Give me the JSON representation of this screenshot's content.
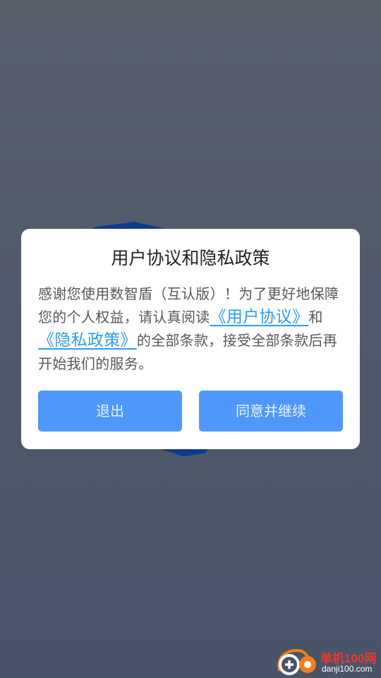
{
  "dialog": {
    "title": "用户协议和隐私政策",
    "body_intro": "感谢您使用数智盾（互认版）！为了更好地保障您的个人权益，请认真阅读",
    "user_agreement_link": "《用户协议》",
    "body_and": "和",
    "privacy_policy_link": "《隐私政策》",
    "body_outro": "的全部条款，接受全部条款后再开始我们的服务。",
    "exit_button": "退出",
    "agree_button": "同意并继续"
  },
  "watermark": {
    "title": "单机100网",
    "url": "danji100.com"
  },
  "colors": {
    "background": "#535b68",
    "button": "#4e98fb",
    "link": "#2f9bf0",
    "background_logo": "#0f3a8c"
  },
  "icons": {
    "background_logo": "app-logo-shield-icon",
    "watermark_logo": "danji100-logo-icon"
  }
}
